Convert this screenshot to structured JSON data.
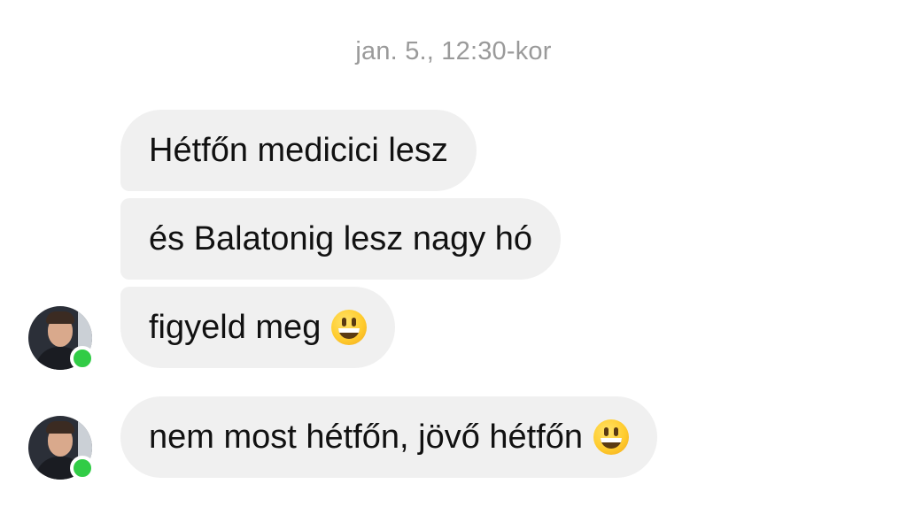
{
  "conversation": {
    "timestamp": "jan. 5., 12:30-kor",
    "messages": [
      {
        "text": "Hétfőn medicici lesz",
        "emoji": null
      },
      {
        "text": "és Balatonig lesz nagy hó",
        "emoji": null
      },
      {
        "text": "figyeld meg",
        "emoji": "grinning-face-emoji"
      },
      {
        "text": "nem most hétfőn, jövő hétfőn",
        "emoji": "grinning-face-emoji"
      }
    ],
    "sender": {
      "online": true,
      "presence_color": "#31cc46"
    },
    "bubble_color": "#f0f0f0"
  }
}
